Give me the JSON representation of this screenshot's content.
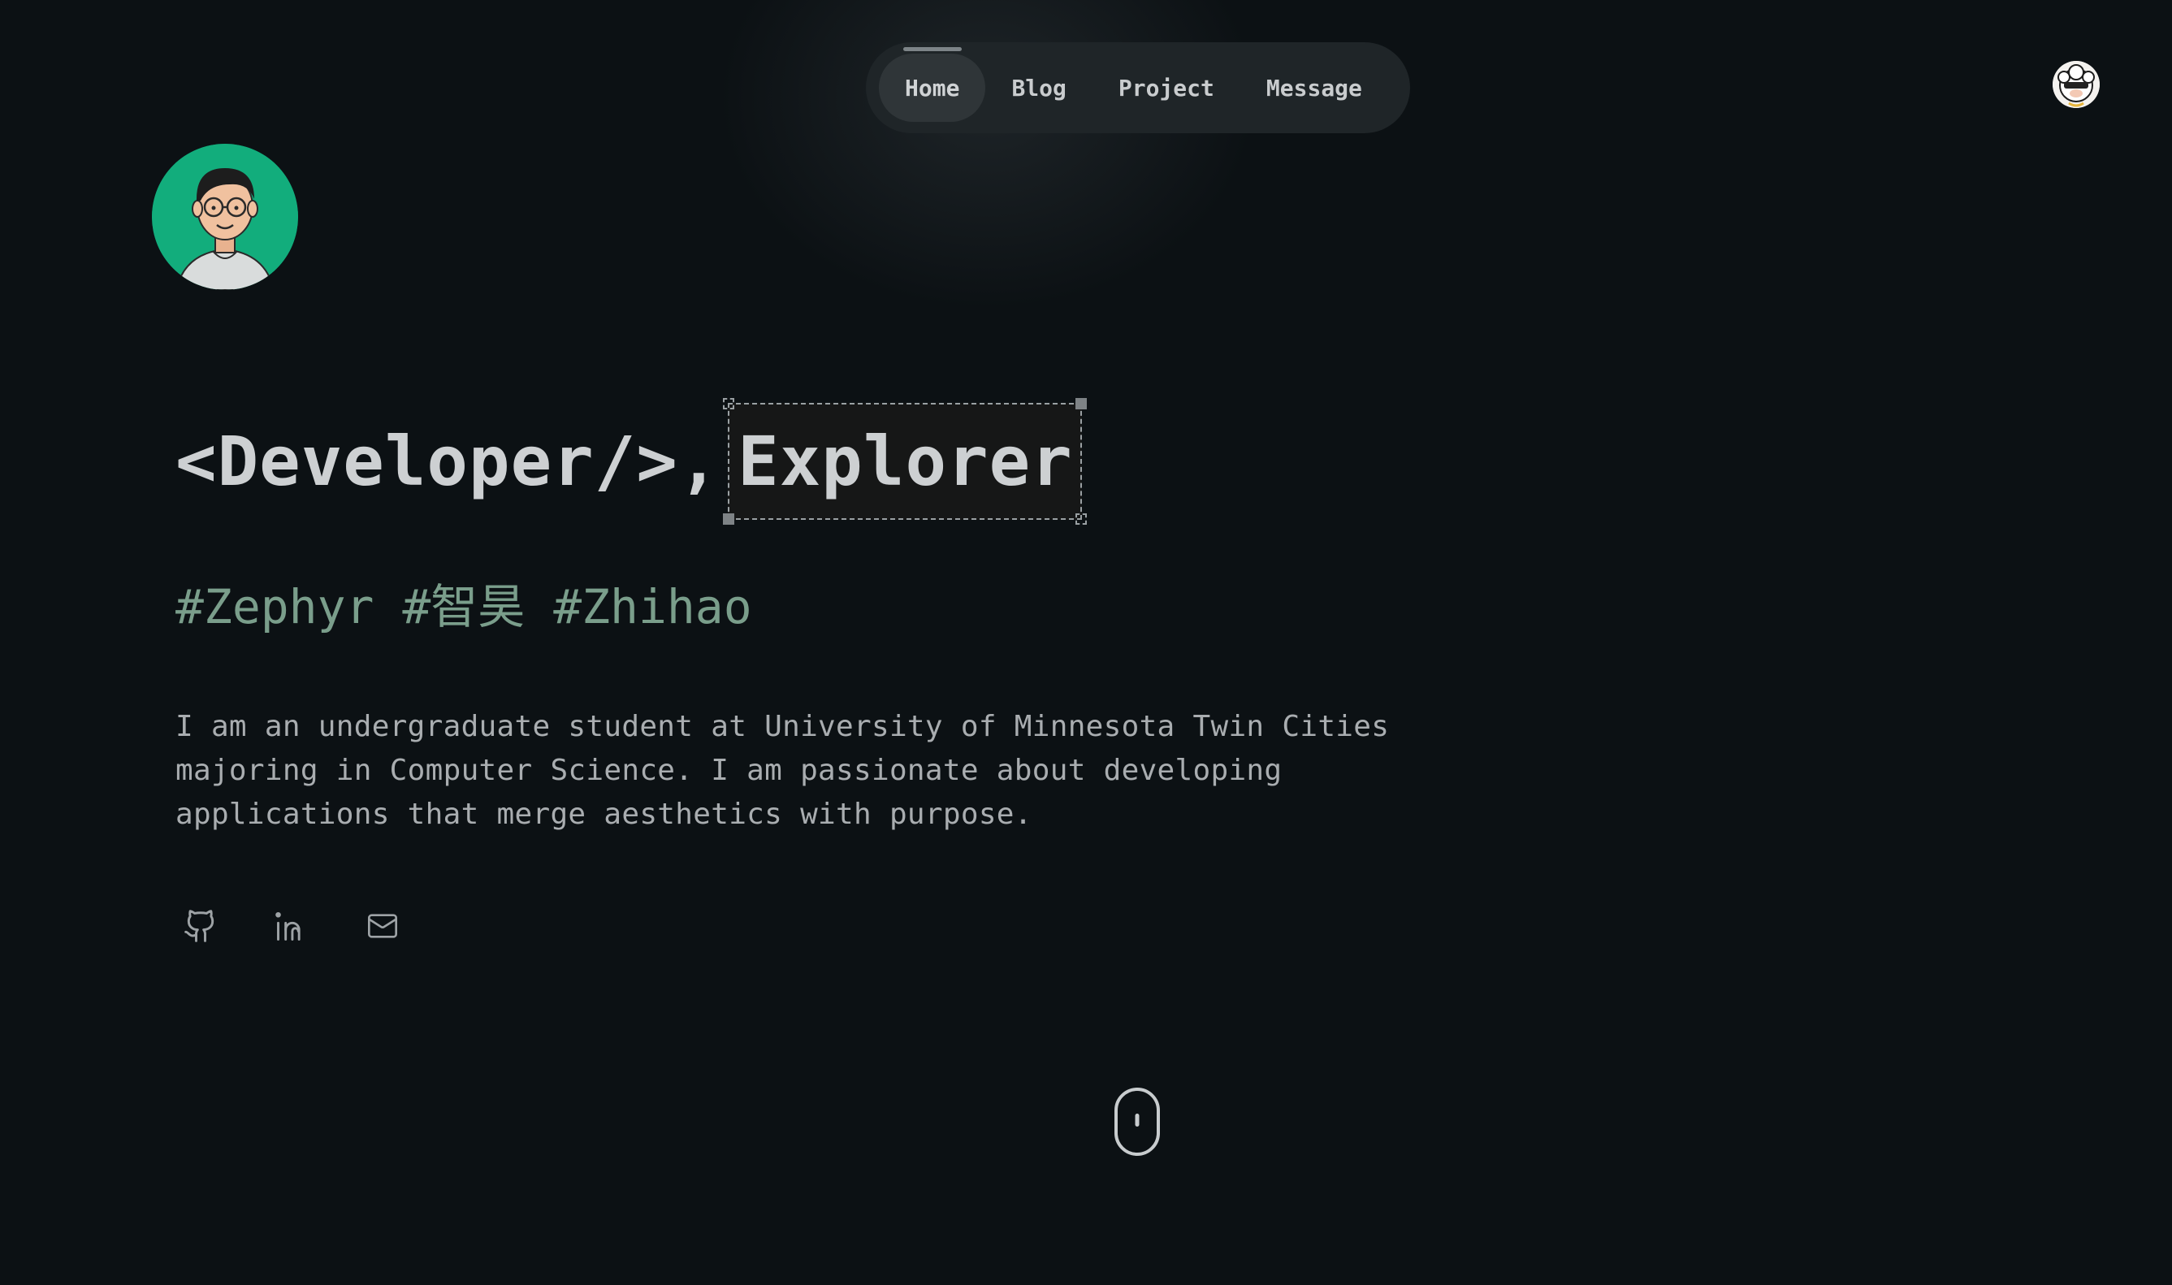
{
  "nav": {
    "items": [
      {
        "label": "Home",
        "active": true
      },
      {
        "label": "Blog",
        "active": false
      },
      {
        "label": "Project",
        "active": false
      },
      {
        "label": "Message",
        "active": false
      }
    ]
  },
  "hero": {
    "headline_prefix": "<Developer/>,",
    "headline_typed": "Explorer",
    "tags": "#Zephyr #智昊 #Zhihao",
    "bio": "I am an undergraduate student at University of Minnesota Twin Cities majoring in Computer Science. I am passionate about developing applications that merge aesthetics with purpose."
  },
  "socials": [
    {
      "icon": "github-icon"
    },
    {
      "icon": "linkedin-icon"
    },
    {
      "icon": "mail-icon"
    }
  ],
  "colors": {
    "background": "#0c1114",
    "nav_bg": "#1f2528",
    "tag_green": "#7a9e8b",
    "avatar_green": "#12ad7c"
  }
}
